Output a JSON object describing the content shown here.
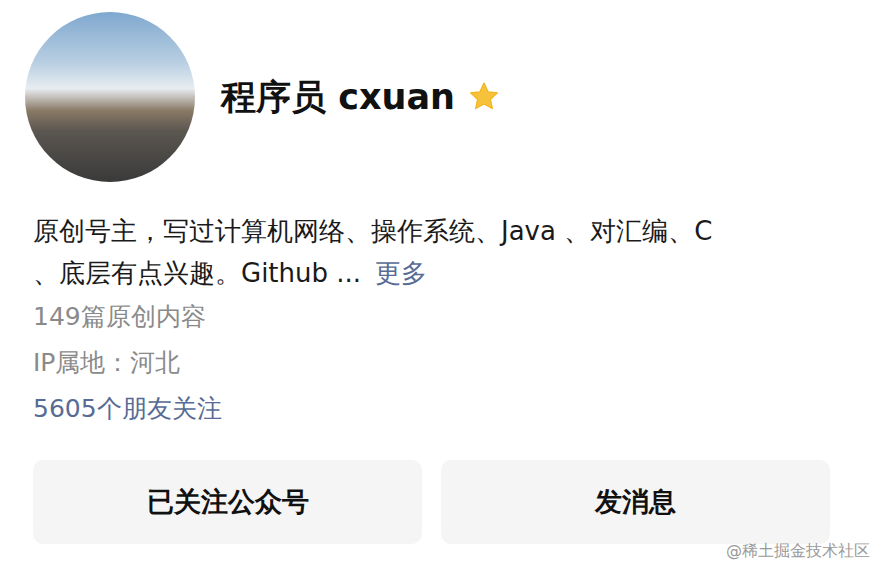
{
  "profile": {
    "name": "程序员 cxuan",
    "starred": true,
    "bio_lines": [
      "原创号主，写过计算机网络、操作系统、Java 、对汇编、C",
      "、底层有点兴趣。Github ..."
    ],
    "more_link": "更多",
    "articles": "149篇原创内容",
    "ip_location": "IP属地：河北",
    "friends_following": "5605个朋友关注"
  },
  "buttons": [
    {
      "label": "已关注公众号"
    },
    {
      "label": "发消息"
    }
  ],
  "watermark": "@稀土掘金技术社区"
}
